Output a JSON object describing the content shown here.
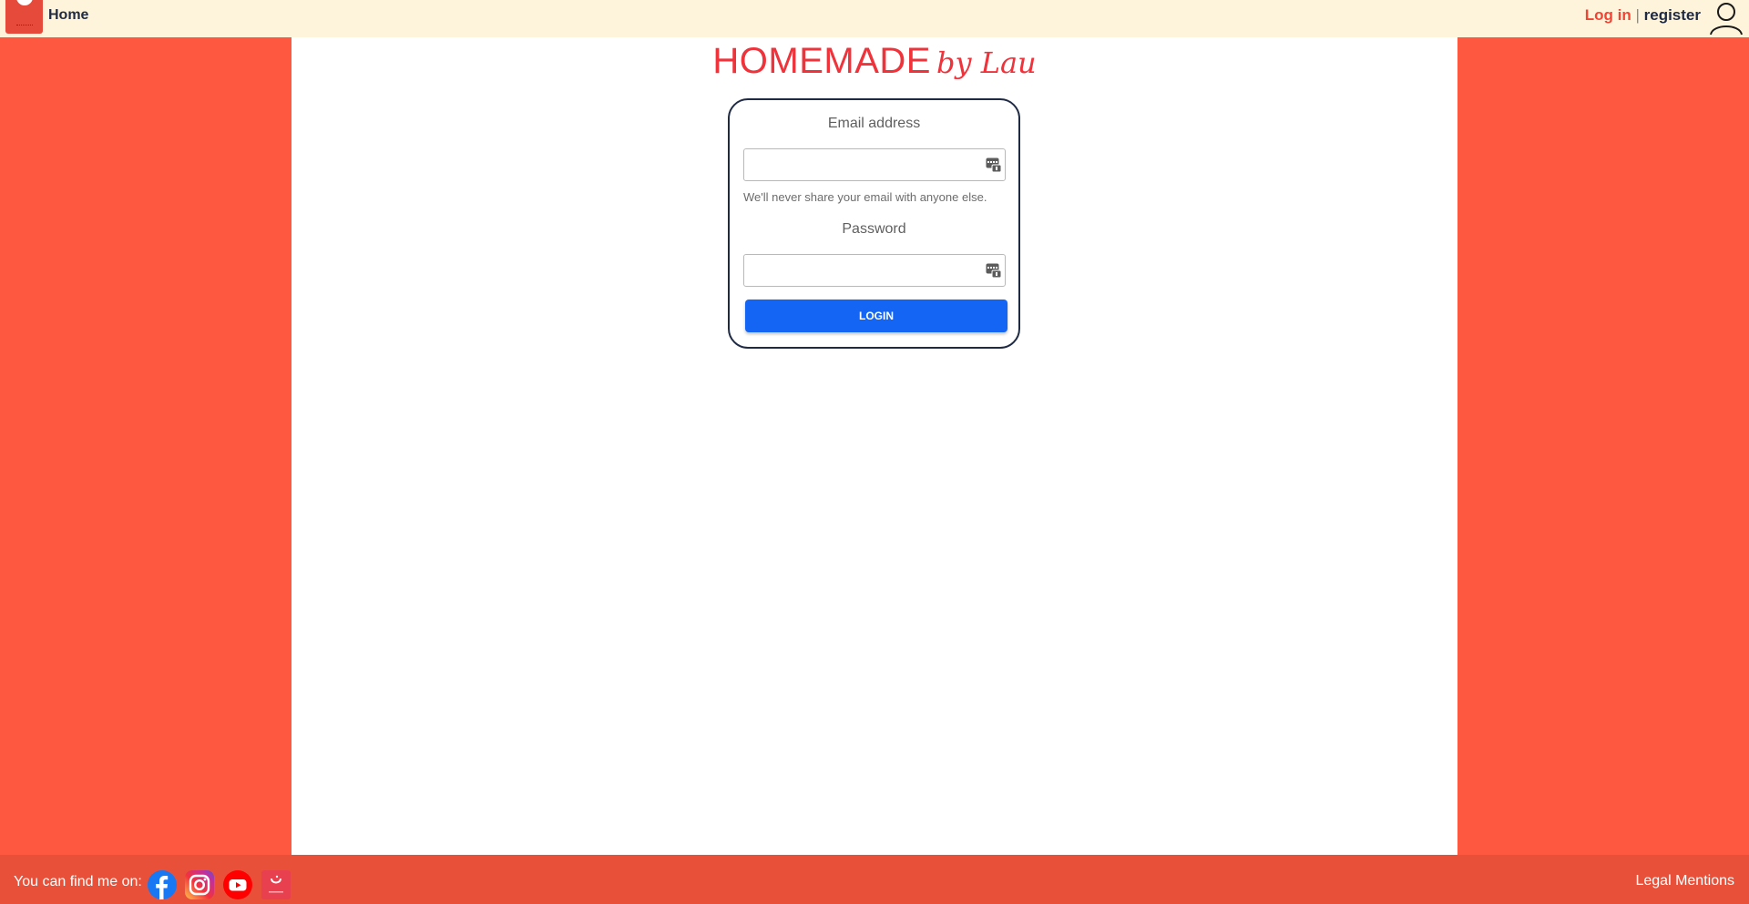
{
  "header": {
    "home_label": "Home",
    "login_label": "Log in",
    "separator": "|",
    "register_label": "register"
  },
  "brand": {
    "title": "HOMEMADE",
    "script": "by Lau",
    "color": "#f0323a"
  },
  "login_form": {
    "email_label": "Email address",
    "email_value": "",
    "email_help": "We'll never share your email with anyone else.",
    "password_label": "Password",
    "password_value": "",
    "submit_label": "LOGIN"
  },
  "footer": {
    "find_me_label": "You can find me on:",
    "social_icons": [
      "facebook-icon",
      "instagram-icon",
      "youtube-icon",
      "marmiton-icon"
    ],
    "legal_label": "Legal Mentions"
  },
  "colors": {
    "page_background": "#fe5840",
    "header_background": "#fef4dc",
    "footer_background": "#e95039",
    "button": "#1565f5",
    "navy": "#1f2a44"
  }
}
